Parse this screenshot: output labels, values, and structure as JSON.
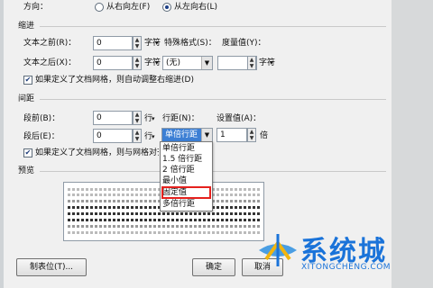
{
  "direction": {
    "label": "方向：",
    "option_rtl": "从右向左(F)",
    "option_ltr": "从左向右(L)"
  },
  "indent": {
    "section_label": "缩进",
    "before_label": "文本之前(R)：",
    "before_value": "0",
    "before_unit": "字符",
    "after_label": "文本之后(X)：",
    "after_value": "0",
    "after_unit": "字符",
    "special_label": "特殊格式(S)：",
    "special_value": "(无)",
    "measure_label": "度量值(Y)：",
    "measure_value": "",
    "measure_unit": "字符",
    "grid_checkbox_label": "如果定义了文档网格，则自动调整右缩进(D)"
  },
  "spacing": {
    "section_label": "间距",
    "before_label": "段前(B)：",
    "before_value": "0",
    "before_unit": "行",
    "after_label": "段后(E)：",
    "after_value": "0",
    "after_unit": "行",
    "line_spacing_label": "行距(N)：",
    "line_spacing_value": "单倍行距",
    "set_value_label": "设置值(A)：",
    "set_value": "1",
    "set_value_unit": "倍",
    "grid_checkbox_label": "如果定义了文档网格，则与网格对齐"
  },
  "line_spacing_options": [
    "单倍行距",
    "1.5 倍行距",
    "2 倍行距",
    "最小值",
    "固定值",
    "多倍行距"
  ],
  "highlighted_option": "固定值",
  "preview": {
    "label": "预览",
    "line_text": "前一段落前一段落前一段落前一段落前一段落前一段落前一段落"
  },
  "buttons": {
    "tabs": "制表位(T)...",
    "ok": "确定",
    "cancel": "取消"
  },
  "watermark": {
    "name": "系统城",
    "url": "XITONGCHENG.COM"
  },
  "colors": {
    "highlight": "#3c7fd4",
    "red_box": "#e5211d",
    "logo_blue": "#1a73d9"
  }
}
